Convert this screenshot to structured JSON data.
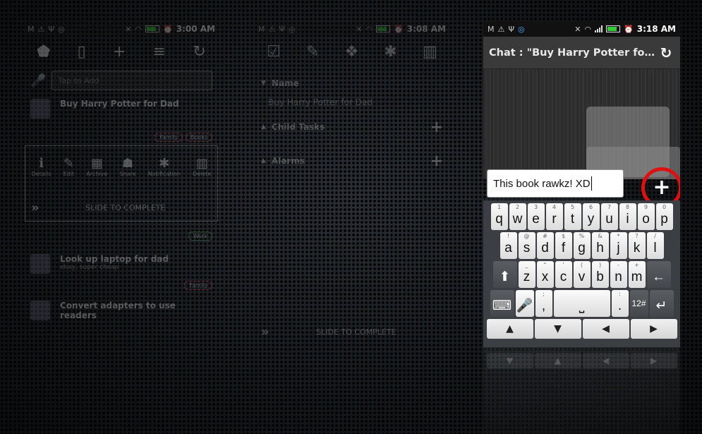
{
  "status": {
    "icons": [
      "gmail-icon",
      "alert-icon",
      "usb-icon",
      "sync-icon",
      "mute-icon",
      "wifi-icon",
      "signal-icon",
      "battery-icon",
      "alarm-icon"
    ],
    "times": [
      "3:00 AM",
      "3:08 AM",
      "3:18 AM"
    ]
  },
  "screen1": {
    "add_placeholder": "Tap to Add",
    "tasks": [
      {
        "title": "Buy Harry Potter for Dad",
        "subtitle": "",
        "tags": [
          "Family",
          "Books"
        ]
      },
      {
        "title": "Look up laptop for dad",
        "subtitle": "ebay, super cheap",
        "tags": [
          "Family"
        ]
      },
      {
        "title": "Convert adapters to use readers",
        "subtitle": "",
        "tags": []
      }
    ],
    "actions": [
      "Details",
      "Edit",
      "Archive",
      "Share",
      "Notification",
      "Delete"
    ],
    "slide_text": "SLIDE TO COMPLETE",
    "tag_mid": "Work"
  },
  "screen2": {
    "name_header": "Name",
    "name_value": "Buy Harry Potter for Dad",
    "child_tasks": "Child Tasks",
    "alarms": "Alarms",
    "slide_text": "SLIDE TO COMPLETE"
  },
  "screen3": {
    "title": "Chat : \"Buy Harry Potter for Dad\"",
    "message_value": "This book rawkz! XD",
    "keyboard": {
      "row1": [
        [
          "1",
          "q"
        ],
        [
          "2",
          "w"
        ],
        [
          "3",
          "e"
        ],
        [
          "4",
          "r"
        ],
        [
          "5",
          "t"
        ],
        [
          "6",
          "y"
        ],
        [
          "7",
          "u"
        ],
        [
          "8",
          "i"
        ],
        [
          "9",
          "o"
        ],
        [
          "0",
          "p"
        ]
      ],
      "row2": [
        [
          "!",
          "a"
        ],
        [
          "@",
          "s"
        ],
        [
          "#",
          "d"
        ],
        [
          "$",
          "f"
        ],
        [
          "%",
          "g"
        ],
        [
          "&",
          "h"
        ],
        [
          "*",
          "j"
        ],
        [
          "?",
          "k"
        ],
        [
          "/",
          "l"
        ]
      ],
      "row3": [
        [
          "_",
          "z"
        ],
        [
          "\"",
          "x"
        ],
        [
          "'",
          "c"
        ],
        [
          "(",
          "v"
        ],
        [
          ")",
          "b"
        ],
        [
          "-",
          "n"
        ],
        [
          "+",
          "m"
        ]
      ],
      "row4_keys": {
        "comma": ",",
        "semicolon": ";",
        "period": ".",
        "colon": ":",
        "symbols": "12#"
      },
      "arrows": [
        "▲",
        "▼",
        "◀",
        "▶"
      ]
    }
  }
}
